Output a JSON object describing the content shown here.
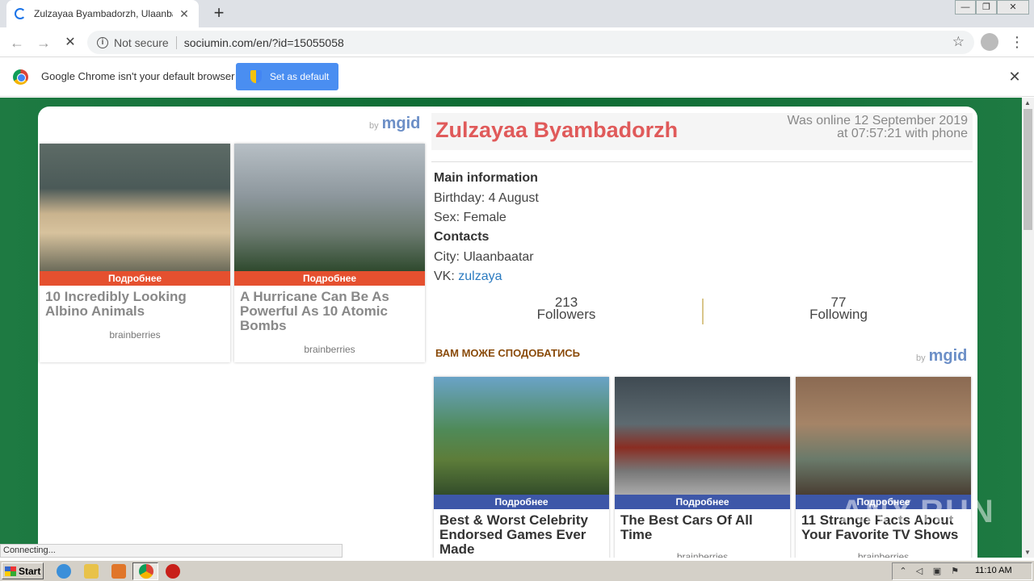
{
  "browser": {
    "tab_title": "Zulzayaa Byambadorzh, Ulaanbaatar",
    "tab_close": "✕",
    "new_tab": "+",
    "window_controls": [
      "—",
      "❐",
      "✕"
    ],
    "nav": {
      "back": "←",
      "forward": "→",
      "reload": "✕"
    },
    "not_secure": "Not secure",
    "url": "sociumin.com/en/?id=15055058",
    "star": "☆",
    "menu": "⋮"
  },
  "infobar": {
    "message": "Google Chrome isn't your default browser",
    "set_default": "Set as default",
    "close": "✕"
  },
  "mgid": {
    "by": "by",
    "brand": "mgid"
  },
  "left_ads": [
    {
      "more": "Подробнее",
      "title": "10 Incredibly Looking Albino Animals",
      "source": "brainberries"
    },
    {
      "more": "Подробнее",
      "title": "A Hurricane Can Be As Powerful As 10 Atomic Bombs",
      "source": "brainberries"
    }
  ],
  "profile": {
    "name": "Zulzayaa Byambadorzh",
    "online_line1": "Was online 12 September 2019",
    "online_line2": "at 07:57:21 with phone",
    "main_info_heading": "Main information",
    "birthday": "Birthday: 4 August",
    "sex": "Sex: Female",
    "contacts_heading": "Contacts",
    "city": "City: Ulaanbaatar",
    "vk_label": "VK: ",
    "vk_link": "zulzaya",
    "followers_count": "213",
    "followers_label": "Followers",
    "following_count": "77",
    "following_label": "Following"
  },
  "recommend_heading": "ВАМ МОЖЕ СПОДОБАТИСЬ",
  "bottom_ads": [
    {
      "more": "Подробнее",
      "title": "Best & Worst Celebrity Endorsed Games Ever Made",
      "source": ""
    },
    {
      "more": "Подробнее",
      "title": "The Best Cars Of All Time",
      "source": "brainberries"
    },
    {
      "more": "Подробнее",
      "title": "11 Strange Facts About Your Favorite TV Shows",
      "source": "brainberries"
    }
  ],
  "status_text": "Connecting...",
  "watermark": "ANY.RUN",
  "taskbar": {
    "start": "Start",
    "clock": "11:10 AM"
  },
  "colors": {
    "accent_blue": "#4a8ef1",
    "name_red": "#e05a5a",
    "left_more_bar": "#e5502f",
    "bottom_more_bar": "#3d57a8",
    "page_green": "#0c6b33"
  }
}
